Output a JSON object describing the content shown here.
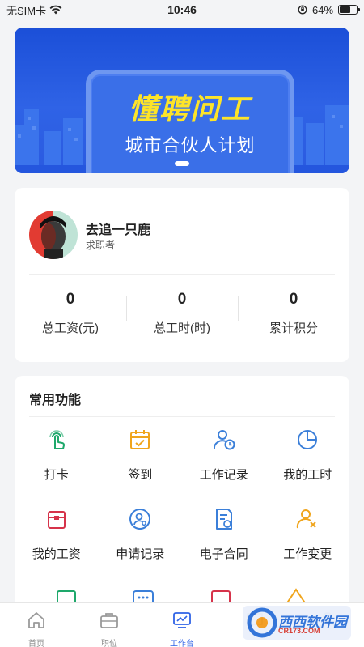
{
  "status_bar": {
    "carrier": "无SIM卡",
    "time": "10:46",
    "battery_percent": "64%",
    "battery_level": 0.64
  },
  "banner": {
    "title": "懂聘问工",
    "subtitle": "城市合伙人计划"
  },
  "profile": {
    "name": "去追一只鹿",
    "role": "求职者",
    "stats": [
      {
        "value": "0",
        "label": "总工资(元)"
      },
      {
        "value": "0",
        "label": "总工时(时)"
      },
      {
        "value": "0",
        "label": "累计积分"
      }
    ]
  },
  "functions": {
    "title": "常用功能",
    "items": [
      {
        "label": "打卡",
        "icon": "tap-icon",
        "color": "#1ea86b"
      },
      {
        "label": "签到",
        "icon": "calendar-check-icon",
        "color": "#f0a51c"
      },
      {
        "label": "工作记录",
        "icon": "user-clock-icon",
        "color": "#3b7fd9"
      },
      {
        "label": "我的工时",
        "icon": "pie-chart-icon",
        "color": "#3b7fd9"
      },
      {
        "label": "我的工资",
        "icon": "wallet-icon",
        "color": "#d6334a"
      },
      {
        "label": "申请记录",
        "icon": "user-shield-icon",
        "color": "#3b7fd9"
      },
      {
        "label": "电子合同",
        "icon": "contract-icon",
        "color": "#3b7fd9"
      },
      {
        "label": "工作变更",
        "icon": "user-remove-icon",
        "color": "#f0a51c"
      }
    ]
  },
  "tabbar": {
    "items": [
      {
        "label": "首页",
        "icon": "home-icon"
      },
      {
        "label": "职位",
        "icon": "briefcase-icon"
      },
      {
        "label": "工作台",
        "icon": "monitor-icon",
        "active": true
      },
      {
        "label": "",
        "icon": "message-icon"
      },
      {
        "label": "",
        "icon": "user-icon"
      }
    ]
  },
  "watermark": {
    "text": "西西软件园",
    "sub": "CR173.COM"
  },
  "colors": {
    "accent": "#2f63e6",
    "banner_title": "#fde428"
  }
}
